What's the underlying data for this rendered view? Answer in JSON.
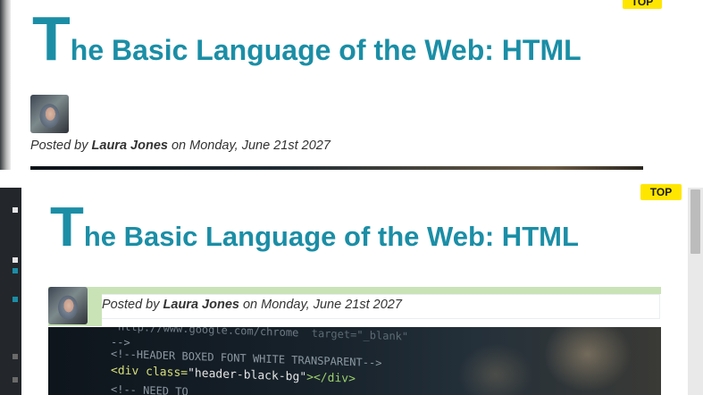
{
  "top_badge": "TOP",
  "post": {
    "title_initial": "T",
    "title_rest": "he Basic Language of the Web: HTML",
    "byline_prefix": "Posted by",
    "author": "Laura Jones",
    "byline_mid": "on",
    "date": "Monday, June 21st 2027"
  },
  "hero_code": {
    "line1": "http://www.google.com/chrome",
    "line1_extra": "target=\"_blank\"",
    "line2": "-->",
    "line3": "<!--HEADER BOXED FONT WHITE TRANSPARENT-->",
    "line4_open": "<div class=",
    "line4_value": "\"header-black-bg\"",
    "line4_close": "></div>",
    "line5": "<!-- NEED TO"
  },
  "colors": {
    "title": "#1b8ea6",
    "badge": "#ffe600",
    "meta_green": "#c9e3b7"
  }
}
